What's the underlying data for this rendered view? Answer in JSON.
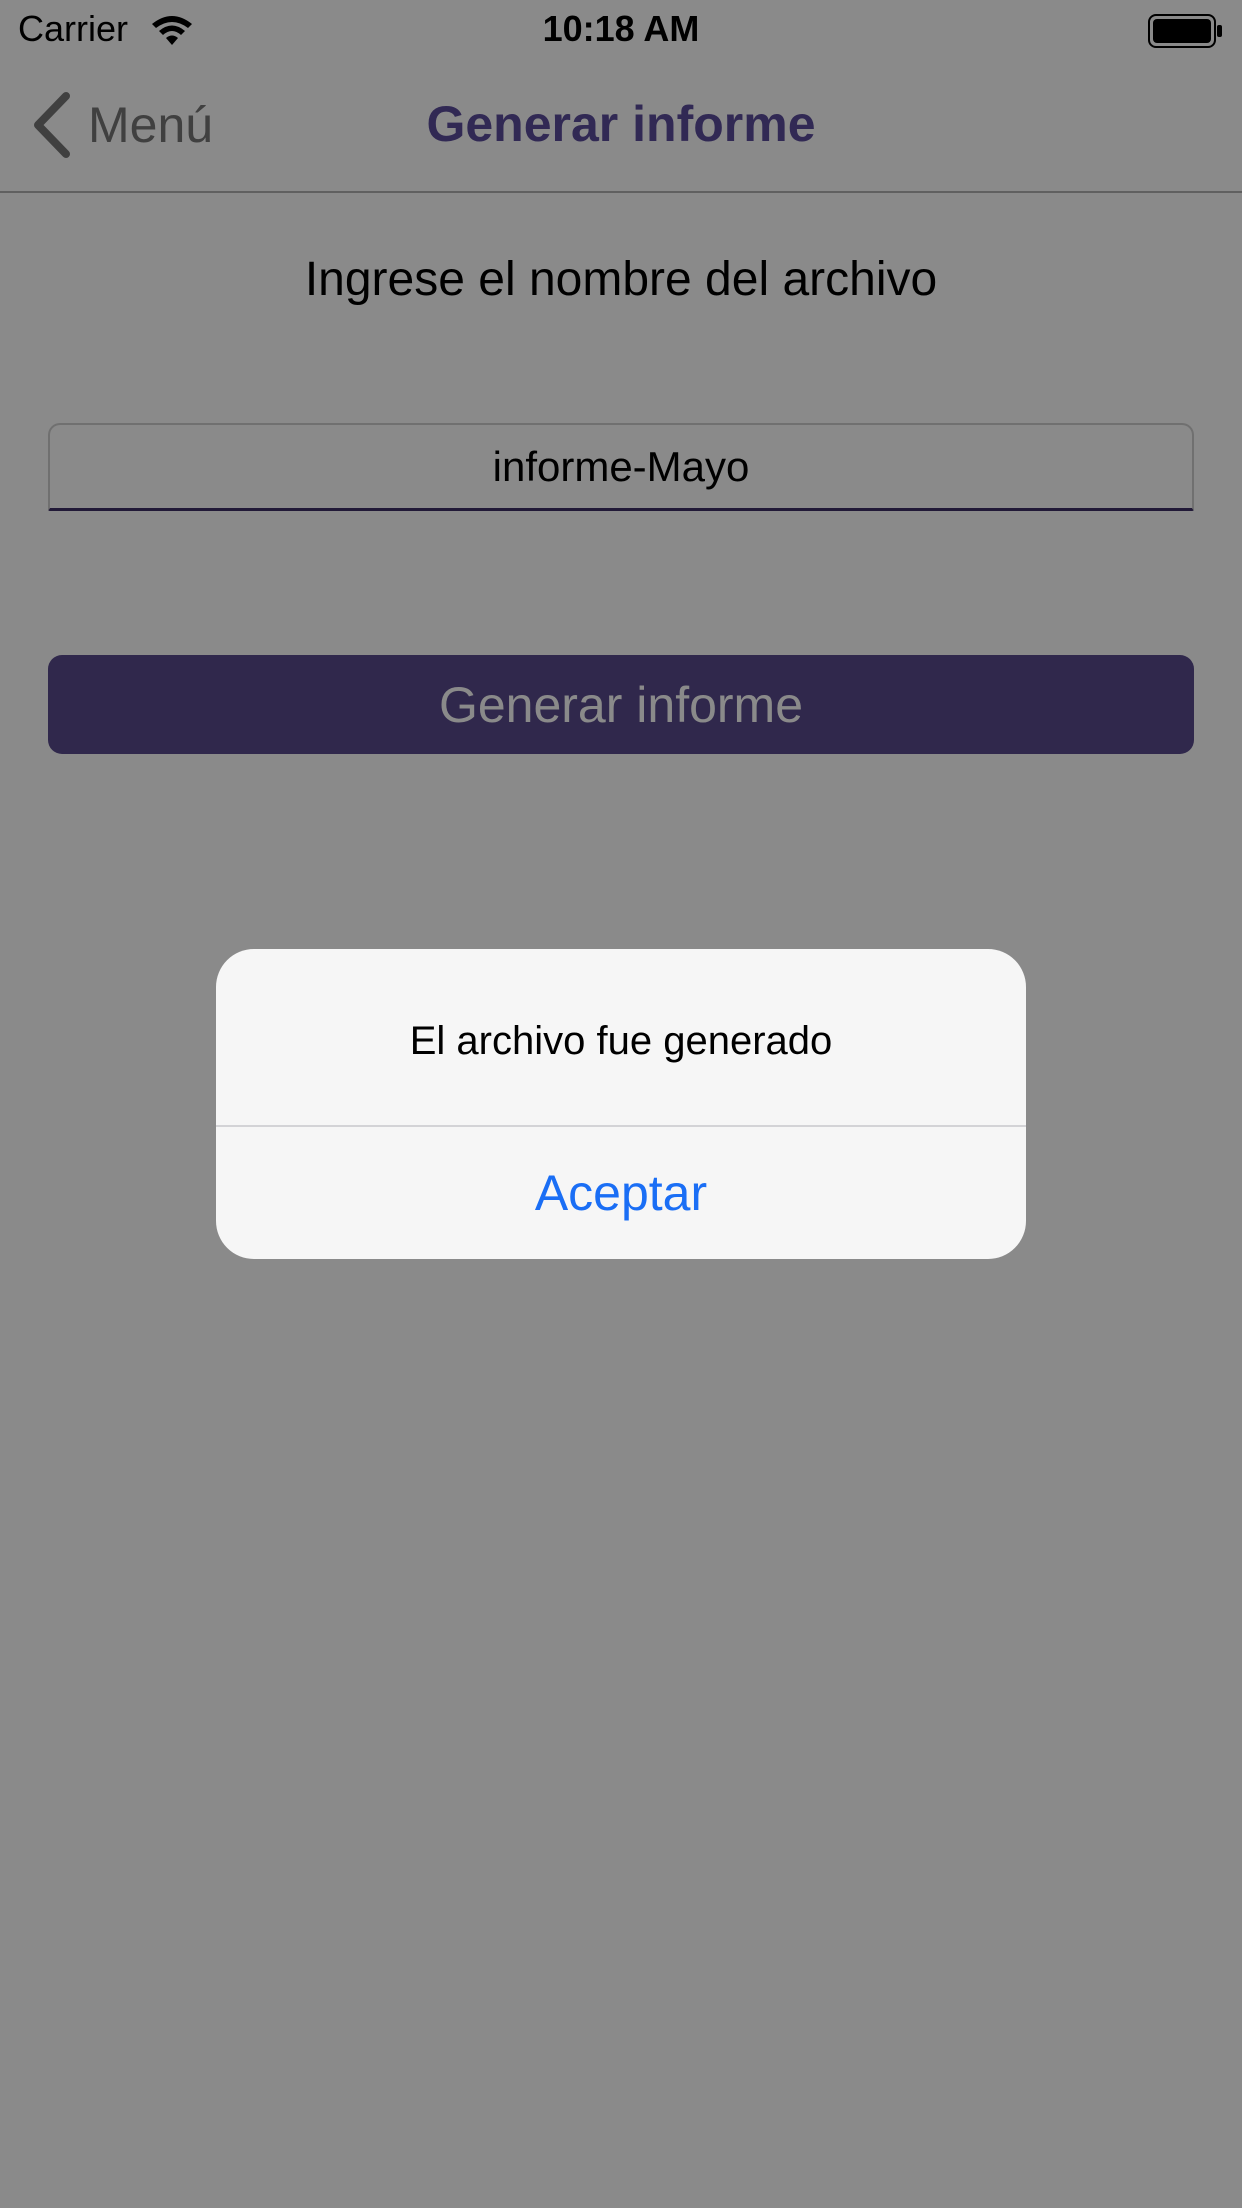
{
  "status_bar": {
    "carrier": "Carrier",
    "time": "10:18 AM",
    "icons": [
      "wifi-icon",
      "battery-icon"
    ]
  },
  "nav_bar": {
    "back_label": "Menú",
    "back_icon": "chevron-left-icon",
    "title": "Generar informe"
  },
  "form": {
    "prompt": "Ingrese el nombre del archivo",
    "filename_value": "informe-Mayo",
    "generate_label": "Generar informe"
  },
  "alert": {
    "message": "El archivo fue generado",
    "button_label": "Aceptar"
  },
  "colors": {
    "accent": "#5b4d9c",
    "button_bg": "#5a4a8c",
    "alert_button": "#1a6ef5",
    "overlay": "rgba(0,0,0,0.46)"
  }
}
